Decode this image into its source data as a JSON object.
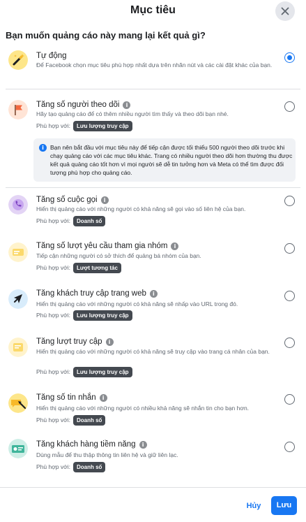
{
  "dialog": {
    "title": "Mục tiêu",
    "question": "Bạn muốn quảng cáo này mang lại kết quả gì?",
    "fit_prefix": "Phù hợp với:"
  },
  "notice": {
    "text": "Bạn nên bắt đầu với mục tiêu này để tiếp cận được tối thiểu 500 người theo dõi trước khi chạy quảng cáo với các mục tiêu khác. Trang có nhiều người theo dõi hơn thường thu được kết quả quảng cáo tốt hơn vì mọi người sẽ dễ tin tưởng hơn và Meta có thể tìm được đối tượng phù hợp cho quảng cáo."
  },
  "options": [
    {
      "title": "Tự động",
      "description": "Để Facebook chọn mục tiêu phù hợp nhất dựa trên nhãn nút và các cài đặt khác của bạn.",
      "fit": "",
      "selected": true,
      "icon": "magic-wand-icon"
    },
    {
      "title": "Tăng số người theo dõi",
      "description": "Hãy tạo quảng cáo để có thêm nhiều người tìm thấy và theo dõi bạn nhé.",
      "fit": "Lưu lượng truy cập",
      "selected": false,
      "icon": "flag-icon"
    },
    {
      "title": "Tăng số cuộc gọi",
      "description": "Hiển thị quảng cáo với những người có khả năng sẽ gọi vào số liên hệ của bạn.",
      "fit": "Doanh số",
      "selected": false,
      "icon": "phone-icon"
    },
    {
      "title": "Tăng số lượt yêu cầu tham gia nhóm",
      "description": "Tiếp cận những người có sở thích để quảng bá nhóm của bạn.",
      "fit": "Lượt tương tác",
      "selected": false,
      "icon": "group-request-icon"
    },
    {
      "title": "Tăng khách truy cập trang web",
      "description": "Hiển thị quảng cáo với những người có khả năng sẽ nhấp vào URL trong đó.",
      "fit": "Lưu lượng truy cập",
      "selected": false,
      "icon": "cursor-icon"
    },
    {
      "title": "Tăng lượt truy cập",
      "description": "Hiển thị quảng cáo với những người có khả năng sẽ truy cập vào trang cá nhân của bạn.",
      "fit": "Lưu lượng truy cập",
      "selected": false,
      "icon": "profile-visit-icon"
    },
    {
      "title": "Tăng số tin nhắn",
      "description": "Hiển thị quảng cáo với những người có nhiều khả năng sẽ nhắn tin cho bạn hơn.",
      "fit": "Doanh số",
      "selected": false,
      "icon": "message-icon"
    },
    {
      "title": "Tăng khách hàng tiềm năng",
      "description": "Dùng mẫu để thu thập thông tin liên hệ và giữ liên lạc.",
      "fit": "Doanh số",
      "selected": false,
      "icon": "lead-form-icon"
    }
  ],
  "footer": {
    "cancel_label": "Hủy",
    "save_label": "Lưu"
  },
  "colors": {
    "accent": "#1877f2",
    "badge": "#444950",
    "notice_bg": "#f0f2f5"
  }
}
